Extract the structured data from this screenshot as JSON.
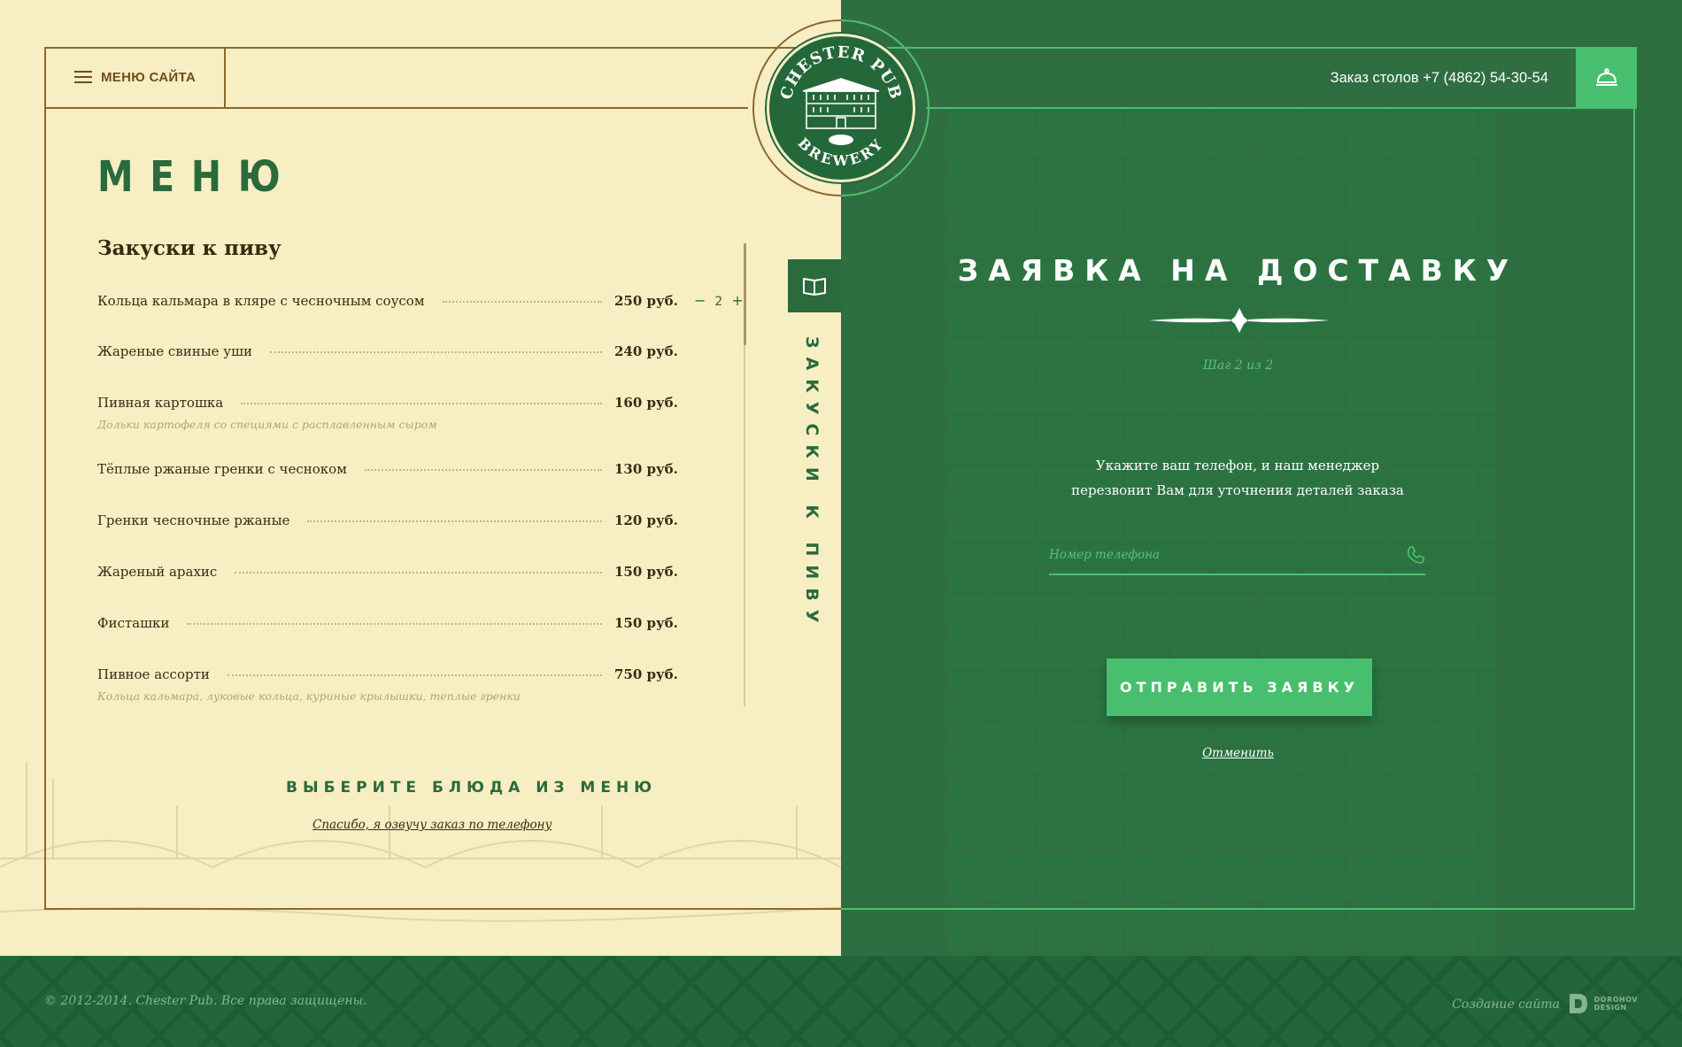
{
  "header": {
    "menu_label": "МЕНЮ САЙТА",
    "reserve_text": "Заказ столов +7 (4862) 54-30-54",
    "bell_icon": "bell-icon"
  },
  "logo": {
    "top_text": "CHESTER PUB",
    "bottom_text": "BREWERY"
  },
  "menu": {
    "title": "МЕНЮ",
    "section_title": "Закуски к пиву",
    "category_tab_label": "ЗАКУСКИ К ПИВУ",
    "items": [
      {
        "name": "Кольца кальмара в кляре с чесночным соусом",
        "price": "250 руб.",
        "desc": "",
        "qty": "2",
        "minus": "−",
        "plus": "+"
      },
      {
        "name": "Жареные свиные уши",
        "price": "240 руб.",
        "desc": ""
      },
      {
        "name": "Пивная картошка",
        "price": "160 руб.",
        "desc": "Дольки картофеля со специями с расплавленным сыром"
      },
      {
        "name": "Тёплые ржаные гренки с чесноком",
        "price": "130 руб.",
        "desc": ""
      },
      {
        "name": "Гренки чесночные ржаные",
        "price": "120 руб.",
        "desc": ""
      },
      {
        "name": "Жареный арахис",
        "price": "150 руб.",
        "desc": ""
      },
      {
        "name": "Фисташки",
        "price": "150 руб.",
        "desc": ""
      },
      {
        "name": "Пивное ассорти",
        "price": "750 руб.",
        "desc": "Кольца кальмара, луковые кольца, куриные крылышки, теплые гренки"
      }
    ],
    "choose_title": "ВЫБЕРИТЕ БЛЮДА ИЗ МЕНЮ",
    "phone_thanks": "Спасибо, я озвучу заказ по телефону"
  },
  "order": {
    "title": "ЗАЯВКА НА ДОСТАВКУ",
    "step": "Шаг 2 из 2",
    "instructions_line1": "Укажите ваш телефон, и наш менеджер",
    "instructions_line2": "перезвонит Вам для уточнения деталей заказа",
    "phone_placeholder": "Номер телефона",
    "phone_value": "",
    "submit_label": "ОТПРАВИТЬ ЗАЯВКУ",
    "cancel_label": "Отменить"
  },
  "footer": {
    "copyright": "© 2012-2014. Chester Pub. Все права защищены.",
    "made_by": "Создание сайта",
    "dev_line1": "DOROHOV",
    "dev_line2": "DESIGN"
  },
  "colors": {
    "accent_green": "#47bf6e",
    "dark_green": "#2a6a3c",
    "cream": "#f8eec4",
    "brown": "#8a6a2c"
  }
}
